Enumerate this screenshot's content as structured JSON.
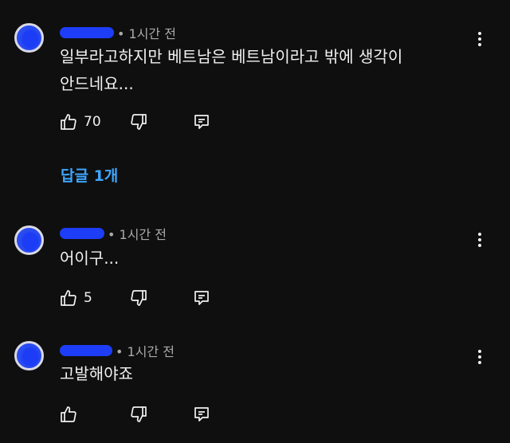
{
  "comments": [
    {
      "time": "• 1시간 전",
      "text": "일부라고하지만 베트남은 베트남이라고 밖에 생각이\n안드네요...",
      "likes": "70",
      "replies_label": "답글 1개"
    },
    {
      "time": "• 1시간 전",
      "text": "어이구...",
      "likes": "5"
    },
    {
      "time": "• 1시간 전",
      "text": "고발해야죠",
      "likes": ""
    }
  ],
  "colors": {
    "background": "#0f0f0f",
    "text": "#f1f1f1",
    "meta": "#aaaaaa",
    "link": "#3ea6ff",
    "redaction": "#1e3df7"
  },
  "icons": {
    "like": "thumbs-up-icon",
    "dislike": "thumbs-down-icon",
    "reply": "reply-icon",
    "menu": "more-vert-icon"
  }
}
